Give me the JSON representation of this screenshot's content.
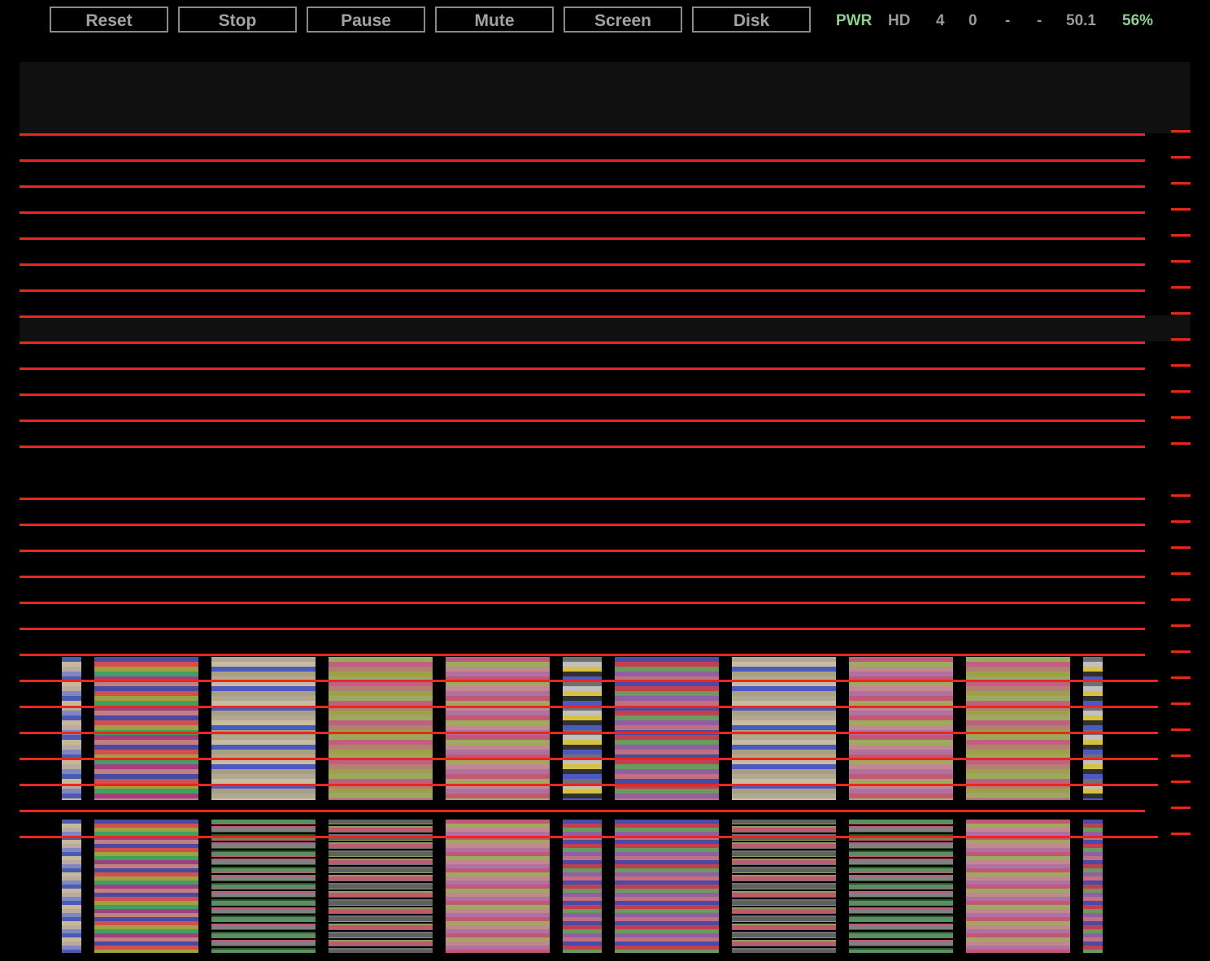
{
  "toolbar": {
    "buttons": [
      {
        "key": "reset",
        "label": "Reset"
      },
      {
        "key": "stop",
        "label": "Stop"
      },
      {
        "key": "pause",
        "label": "Pause"
      },
      {
        "key": "mute",
        "label": "Mute"
      },
      {
        "key": "screen",
        "label": "Screen"
      },
      {
        "key": "disk",
        "label": "Disk"
      }
    ],
    "indicators": [
      {
        "key": "pwr",
        "label": "PWR",
        "active": true
      },
      {
        "key": "hd",
        "label": "HD",
        "active": false
      },
      {
        "key": "v1",
        "label": "4",
        "active": false
      },
      {
        "key": "v2",
        "label": "0",
        "active": false
      },
      {
        "key": "v3",
        "label": "-",
        "active": false
      },
      {
        "key": "v4",
        "label": "-",
        "active": false
      },
      {
        "key": "v5",
        "label": "50.1",
        "active": false
      },
      {
        "key": "pct",
        "label": "56%",
        "active": true
      }
    ]
  },
  "screen": {
    "line_color": "#e8281e",
    "band_color": "#101010",
    "background": "#000000",
    "palettes": {
      "blue_beige": [
        "#4b5bb0",
        "#c8b89a",
        "#b8aaa0",
        "#7f86c0"
      ],
      "rainbow": [
        "#4a4aa0",
        "#d05050",
        "#a0a040",
        "#40a060",
        "#a04080",
        "#c08080"
      ],
      "tan_blue": [
        "#b0a890",
        "#c8bca0",
        "#4a5ac0",
        "#a8a080"
      ],
      "olive_pink": [
        "#9ca860",
        "#c06080",
        "#b08070",
        "#a0a048"
      ],
      "pink_olive": [
        "#c05878",
        "#a0a860",
        "#c08890",
        "#b070a0"
      ],
      "gray_yellow": [
        "#707070",
        "#c0c0c0",
        "#d8c040",
        "#303030",
        "#4a5ac0"
      ],
      "purple_red": [
        "#4a4aa8",
        "#c04050",
        "#6a9a60",
        "#9060a0",
        "#c07080"
      ],
      "olive_gray": [
        "#606060",
        "#8aa060",
        "#c05870",
        "#707070"
      ],
      "green_pink": [
        "#5a9060",
        "#c05878",
        "#808080",
        "#305030"
      ]
    }
  }
}
